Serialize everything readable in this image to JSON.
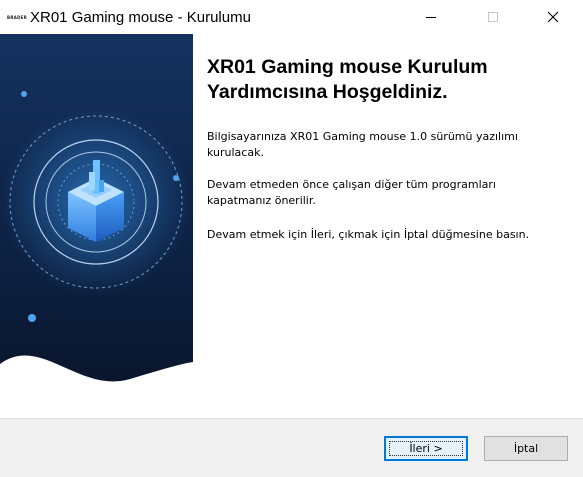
{
  "window": {
    "title": "XR01 Gaming mouse - Kurulumu",
    "app_icon_text": "BRADER"
  },
  "content": {
    "heading_line1": "XR01 Gaming mouse Kurulum",
    "heading_line2": "Yardımcısına Hoşgeldiniz.",
    "para1_line1": "Bilgisayarınıza XR01 Gaming mouse 1.0 sürümü yazılımı",
    "para1_line2": "kurulacak.",
    "para2_line1": "Devam etmeden önce çalışan diğer tüm programları",
    "para2_line2": "kapatmanız önerilir.",
    "para3": "Devam etmek için İleri, çıkmak için İptal düğmesine basın."
  },
  "buttons": {
    "next_label": "İleri >",
    "cancel_label": "İptal"
  },
  "icons": {
    "minimize": "minimize-icon",
    "maximize": "maximize-icon",
    "close": "close-icon"
  },
  "colors": {
    "banner_dark": "#0b1d3a",
    "banner_accent": "#2e8fe0",
    "focus_border": "#0078d7"
  }
}
